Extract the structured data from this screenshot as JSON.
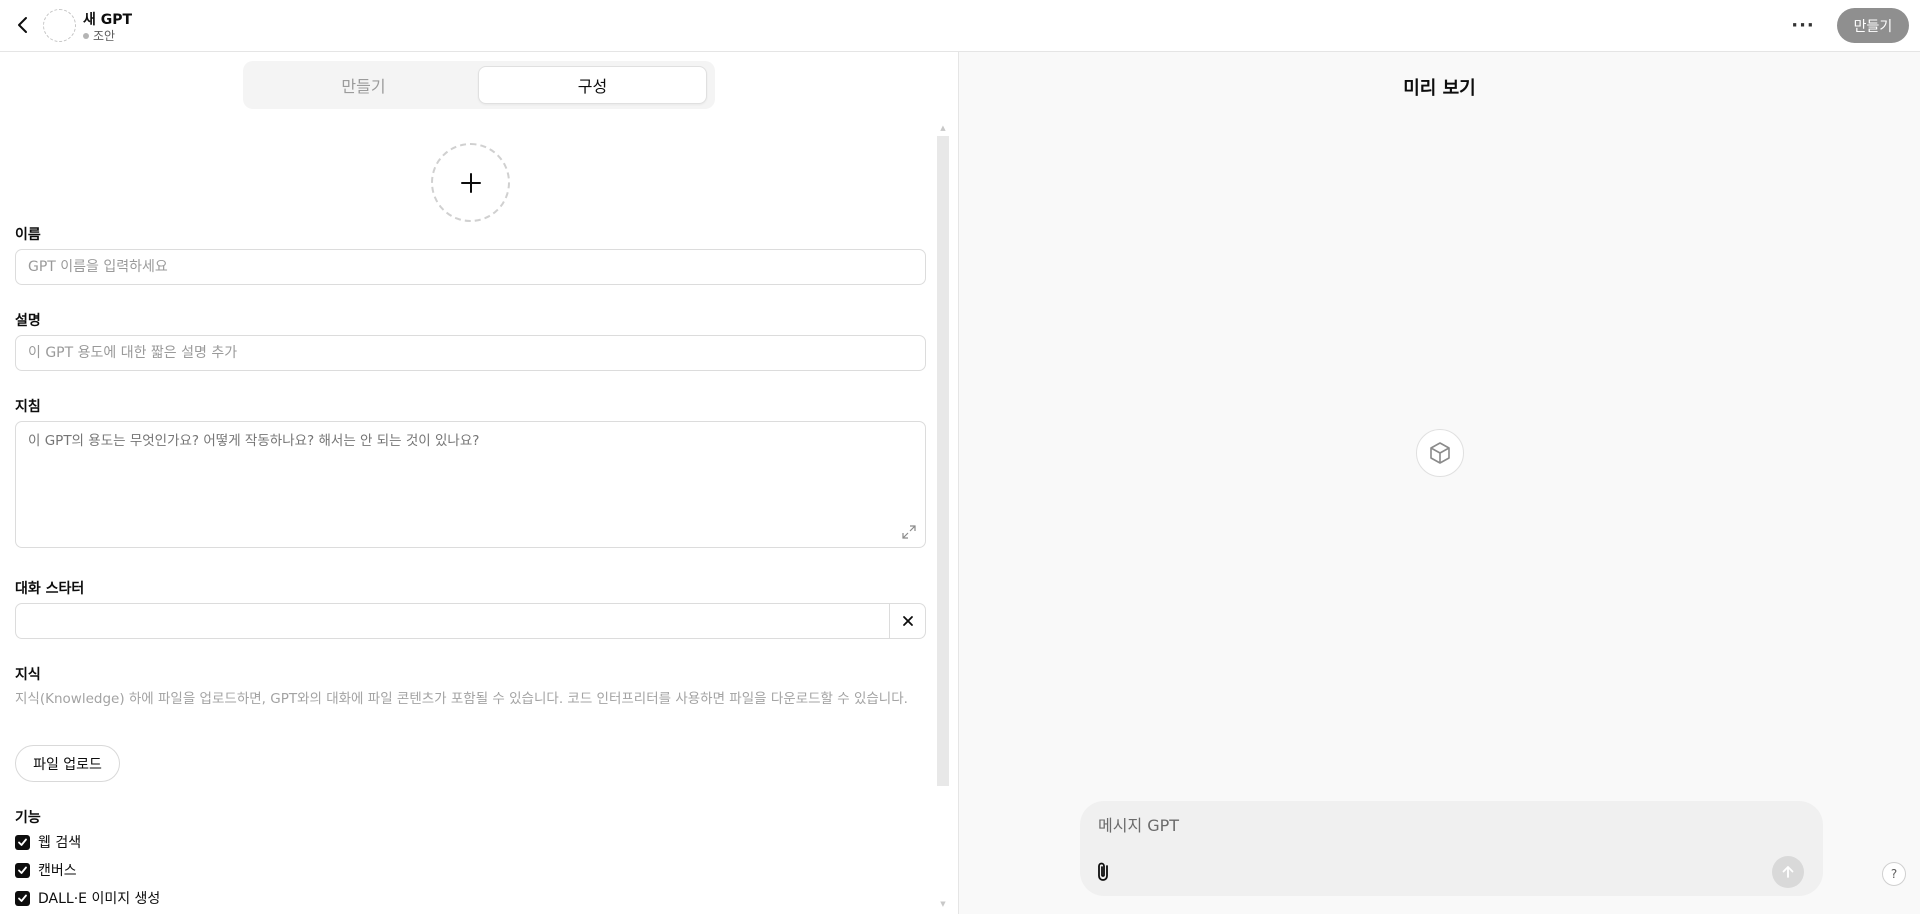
{
  "header": {
    "title": "새 GPT",
    "status": "조안",
    "more_label": "···",
    "create_button": "만들기"
  },
  "tabs": [
    {
      "label": "만들기",
      "active": false
    },
    {
      "label": "구성",
      "active": true
    }
  ],
  "form": {
    "name": {
      "label": "이름",
      "placeholder": "GPT 이름을 입력하세요",
      "value": ""
    },
    "description": {
      "label": "설명",
      "placeholder": "이 GPT 용도에 대한 짧은 설명 추가",
      "value": ""
    },
    "instructions": {
      "label": "지침",
      "placeholder": "이 GPT의 용도는 무엇인가요? 어떻게 작동하나요? 해서는 안 되는 것이 있나요?",
      "value": ""
    },
    "conversation_starters": {
      "label": "대화 스타터",
      "value": ""
    },
    "knowledge": {
      "label": "지식",
      "description": "지식(Knowledge) 하에 파일을 업로드하면, GPT와의 대화에 파일 콘텐츠가 포함될 수 있습니다. 코드 인터프리터를 사용하면 파일을 다운로드할 수 있습니다.",
      "upload_button": "파일 업로드"
    },
    "capabilities": {
      "label": "기능",
      "items": [
        {
          "label": "웹 검색",
          "checked": true
        },
        {
          "label": "캔버스",
          "checked": true
        },
        {
          "label": "DALL·E 이미지 생성",
          "checked": true
        }
      ]
    }
  },
  "preview": {
    "title": "미리 보기",
    "composer_placeholder": "메시지 GPT",
    "help_label": "?"
  },
  "colors": {
    "create_button_bg": "#8f8f8f",
    "checkbox": "#0d0d0d",
    "preview_bg": "#f9f9f9"
  }
}
